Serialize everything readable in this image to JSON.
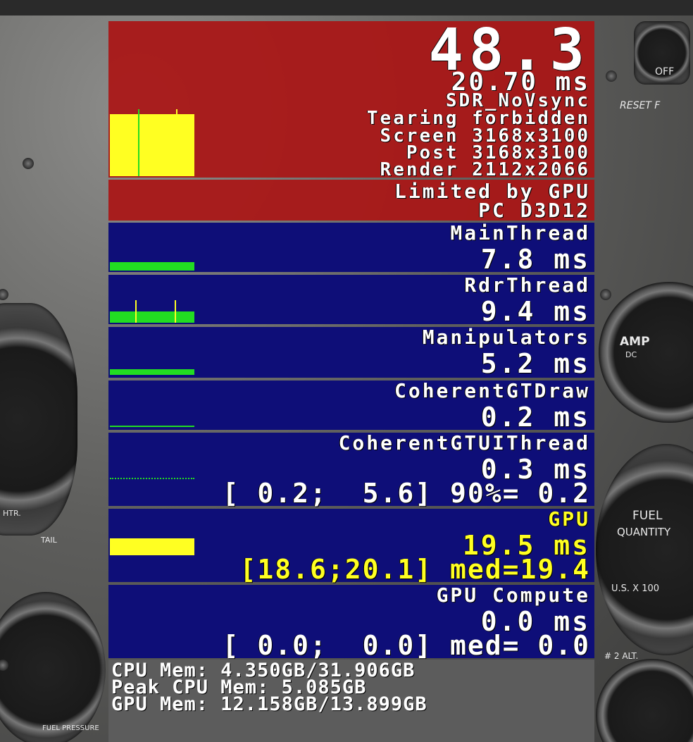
{
  "background": {
    "switch_off_label": "OFF",
    "switch_reset_label": "RESET F",
    "amp_label": "AMP",
    "amp_dc": "DC",
    "fuel_label": "FUEL",
    "fuel_quantity": "QUANTITY",
    "fuel_unit": "U.S. X 100",
    "alt_label": "# 2 ALT.",
    "htr_label": "HTR.",
    "tail_label": "TAIL",
    "fuel_pressure": "FUEL PRESSURE"
  },
  "fps": {
    "fps_value": "48.3",
    "frame_time": "20.70 ms",
    "mode": "SDR_NoVsync",
    "tearing": "Tearing forbidden",
    "screen": "Screen 3168x3100",
    "post": "Post 3168x3100",
    "render": "Render 2112x2066"
  },
  "limit": {
    "limited": "Limited by GPU",
    "api": "PC D3D12"
  },
  "threads": [
    {
      "name": "MainThread",
      "time": "7.8 ms"
    },
    {
      "name": "RdrThread",
      "time": "9.4 ms"
    },
    {
      "name": "Manipulators",
      "time": "5.2 ms"
    },
    {
      "name": "CoherentGTDraw",
      "time": "0.2 ms"
    },
    {
      "name": "CoherentGTUIThread",
      "time": "0.3 ms",
      "stats": "[ 0.2;  5.6] 90%= 0.2"
    }
  ],
  "gpu": {
    "name": "GPU",
    "time": "19.5 ms",
    "stats": "[18.6;20.1] med=19.4"
  },
  "gpu_compute": {
    "name": "GPU Compute",
    "time": "0.0 ms",
    "stats": "[ 0.0;  0.0] med= 0.0"
  },
  "memory": {
    "cpu_mem": "CPU Mem: 4.350GB/31.906GB",
    "peak_cpu_mem": "Peak CPU Mem: 5.085GB",
    "gpu_mem": "GPU Mem: 12.158GB/13.899GB"
  },
  "colors": {
    "red_panel": "#aa1616",
    "blue_panel": "#0e0e78",
    "graph_green": "#22dd22",
    "graph_yellow": "#ffff22"
  }
}
